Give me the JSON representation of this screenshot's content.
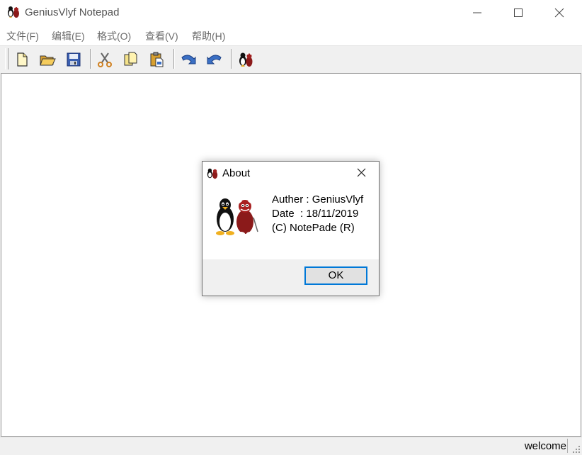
{
  "window": {
    "title": "GeniusVlyf Notepad",
    "controls": [
      "minimize",
      "maximize",
      "close"
    ]
  },
  "menu": [
    "文件(F)",
    "编辑(E)",
    "格式(O)",
    "查看(V)",
    "帮助(H)"
  ],
  "toolbar": {
    "buttons": [
      "new-file-icon",
      "open-folder-icon",
      "save-icon",
      "cut-icon",
      "copy-icon",
      "paste-icon",
      "undo-icon",
      "redo-icon",
      "about-icon"
    ]
  },
  "editor": {
    "content": ""
  },
  "status": {
    "text": "welcome"
  },
  "dialog": {
    "title": "About",
    "lines": [
      "Auther : GeniusVlyf",
      "Date  : 18/11/2019",
      "(C) NotePade (R)"
    ],
    "ok_label": "OK"
  },
  "colors": {
    "accent": "#0078d7",
    "dialog_bg": "#f0f0f0",
    "toolbar_bg": "#f0f0f0",
    "icon_blue": "#3a6fc4",
    "icon_folder": "#e8b84a"
  }
}
